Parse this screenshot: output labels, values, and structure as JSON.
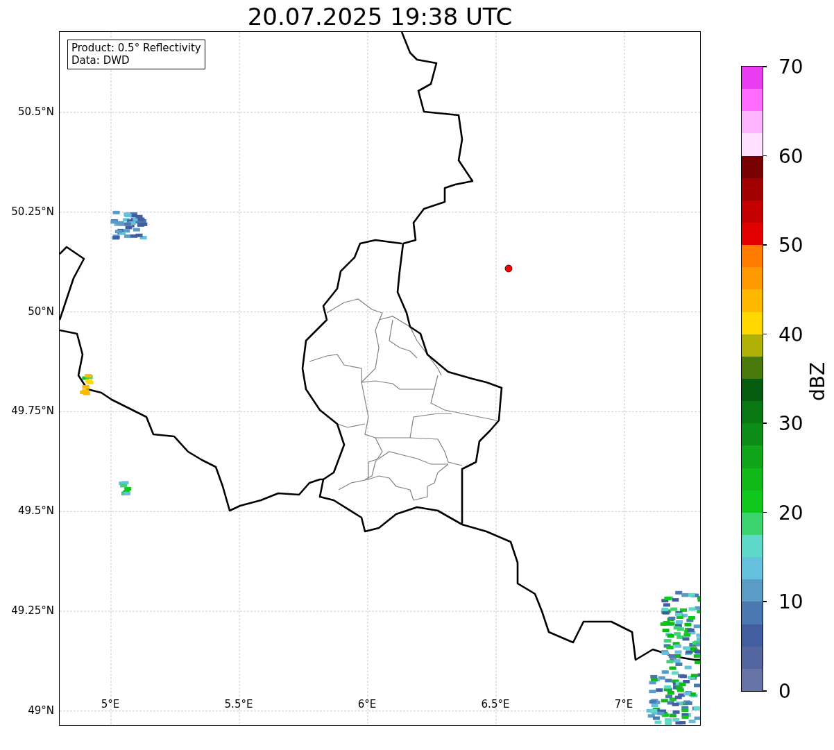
{
  "title": "20.07.2025 19:38 UTC",
  "info_box": [
    "Product: 0.5° Reflectivity",
    "Data: DWD"
  ],
  "map": {
    "y_ticks": [
      "50.5°N",
      "50.25°N",
      "50°N",
      "49.75°N",
      "49.5°N",
      "49.25°N",
      "49°N"
    ],
    "x_ticks": [
      "5°E",
      "5.5°E",
      "6°E",
      "6.5°E",
      "7°E"
    ]
  },
  "colorbar": {
    "label": "dBZ",
    "ticks": [
      "70",
      "60",
      "50",
      "40",
      "30",
      "20",
      "10",
      "0"
    ],
    "levels": [
      {
        "color": "#e83cf0"
      },
      {
        "color": "#ff6cff"
      },
      {
        "color": "#ffb4ff"
      },
      {
        "color": "#ffe0ff"
      },
      {
        "color": "#780000"
      },
      {
        "color": "#a00000"
      },
      {
        "color": "#c40000"
      },
      {
        "color": "#e20000"
      },
      {
        "color": "#ff7c00"
      },
      {
        "color": "#ff9a00"
      },
      {
        "color": "#ffb800"
      },
      {
        "color": "#ffd800"
      },
      {
        "color": "#b0b006"
      },
      {
        "color": "#4a7a0c"
      },
      {
        "color": "#065c0e"
      },
      {
        "color": "#0a7812"
      },
      {
        "color": "#0e8c18"
      },
      {
        "color": "#10a418"
      },
      {
        "color": "#10b818"
      },
      {
        "color": "#10c81c"
      },
      {
        "color": "#3cd46e"
      },
      {
        "color": "#5ed8c8"
      },
      {
        "color": "#64c0dc"
      },
      {
        "color": "#5a9cc6"
      },
      {
        "color": "#4a78b0"
      },
      {
        "color": "#425ea0"
      },
      {
        "color": "#5466a0"
      },
      {
        "color": "#6674a8"
      }
    ]
  }
}
